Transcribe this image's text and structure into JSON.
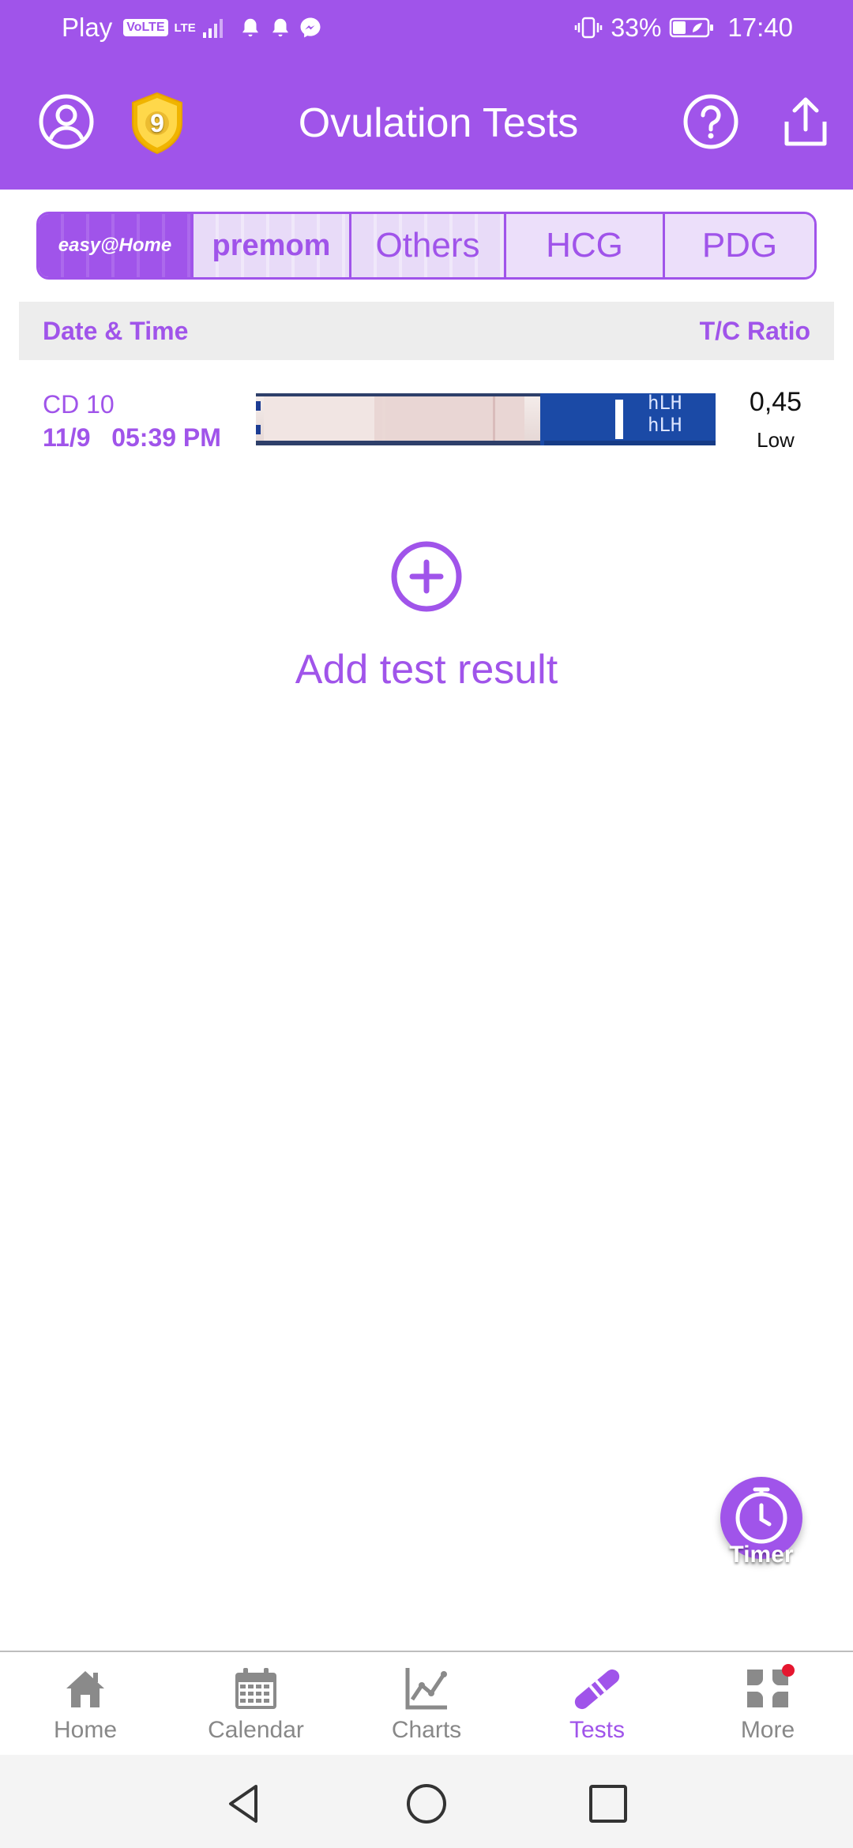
{
  "status_bar": {
    "carrier": "Play",
    "volte": "VoLTE",
    "network": "LTE",
    "battery": "33%",
    "time": "17:40"
  },
  "app_bar": {
    "title": "Ovulation Tests",
    "badge_level": "9"
  },
  "brand_tabs": [
    {
      "label": "easy@Home",
      "active": true
    },
    {
      "label": "premom",
      "active": false
    },
    {
      "label": "Others",
      "active": false
    },
    {
      "label": "HCG",
      "active": false
    },
    {
      "label": "PDG",
      "active": false
    }
  ],
  "table": {
    "header_left": "Date & Time",
    "header_right": "T/C Ratio",
    "rows": [
      {
        "cycle_day": "CD 10",
        "datetime": "11/9   05:39 PM",
        "strip_text": [
          "hLH",
          "hLH"
        ],
        "ratio": "0,45",
        "level": "Low"
      }
    ]
  },
  "add_result": {
    "label": "Add test result"
  },
  "timer": {
    "label": "Timer"
  },
  "bottom_nav": [
    {
      "label": "Home",
      "icon": "home-icon",
      "active": false
    },
    {
      "label": "Calendar",
      "icon": "calendar-icon",
      "active": false
    },
    {
      "label": "Charts",
      "icon": "chart-icon",
      "active": false
    },
    {
      "label": "Tests",
      "icon": "test-strip-icon",
      "active": true
    },
    {
      "label": "More",
      "icon": "more-grid-icon",
      "active": false,
      "notification": true
    }
  ],
  "colors": {
    "accent": "#a054ea",
    "nav_inactive": "#888888",
    "notification": "#e5162f"
  }
}
